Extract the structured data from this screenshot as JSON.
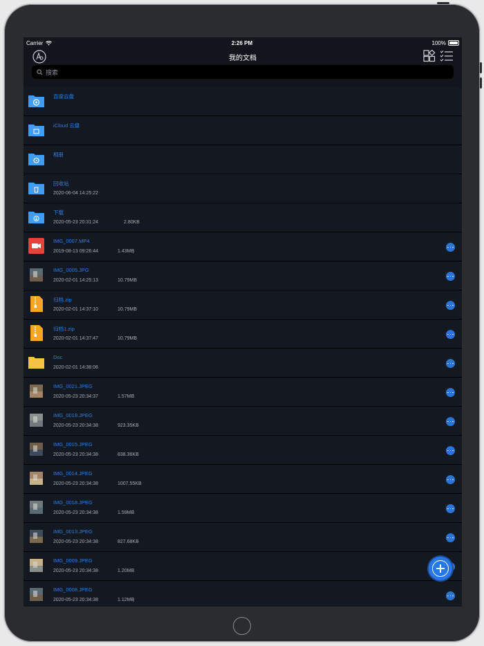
{
  "status_bar": {
    "carrier": "Carrier",
    "time": "2:26 PM",
    "battery": "100%"
  },
  "nav": {
    "title": "我的文档"
  },
  "search": {
    "placeholder": "搜索"
  },
  "files": [
    {
      "name": "百度云盘",
      "date": "",
      "size": "",
      "icon": "folder-baidu-icon",
      "more": false
    },
    {
      "name": "iCloud 云盘",
      "date": "",
      "size": "",
      "icon": "folder-icloud-icon",
      "more": false
    },
    {
      "name": "相册",
      "date": "",
      "size": "",
      "icon": "folder-photos-icon",
      "more": false
    },
    {
      "name": "回收站",
      "date": "2020-06-04 14:25:22",
      "size": "",
      "icon": "folder-trash-icon",
      "more": false
    },
    {
      "name": "下载",
      "date": "2020-05-23 20:31:24",
      "size": "2.80KB",
      "icon": "folder-download-icon",
      "more": false
    },
    {
      "name": "IMG_0007.MP4",
      "date": "2019-08-13 09:26:44",
      "size": "1.43MB",
      "icon": "video-icon",
      "more": true
    },
    {
      "name": "IMG_0005.JPG",
      "date": "2020-02-01 14:25:13",
      "size": "10.79MB",
      "icon": "image-thumbnail",
      "more": true
    },
    {
      "name": "归档.zip",
      "date": "2020-02-01 14:37:10",
      "size": "10.79MB",
      "icon": "zip-icon",
      "more": true
    },
    {
      "name": "归档1.zip",
      "date": "2020-02-01 14:37:47",
      "size": "10.79MB",
      "icon": "zip-icon",
      "more": true
    },
    {
      "name": "Doc",
      "date": "2020-02-01 14:38:06",
      "size": "",
      "icon": "folder-yellow-icon",
      "more": true
    },
    {
      "name": "IMG_0021.JPEG",
      "date": "2020-05-23 20:34:37",
      "size": "1.57MB",
      "icon": "image-thumbnail",
      "more": true
    },
    {
      "name": "IMG_0019.JPEG",
      "date": "2020-05-23 20:34:38",
      "size": "923.35KB",
      "icon": "image-thumbnail",
      "more": true
    },
    {
      "name": "IMG_0015.JPEG",
      "date": "2020-05-23 20:34:38",
      "size": "838.36KB",
      "icon": "image-thumbnail",
      "more": true
    },
    {
      "name": "IMG_0014.JPEG",
      "date": "2020-05-23 20:34:38",
      "size": "1007.55KB",
      "icon": "image-thumbnail",
      "more": true
    },
    {
      "name": "IMG_0018.JPEG",
      "date": "2020-05-23 20:34:38",
      "size": "1.59MB",
      "icon": "image-thumbnail",
      "more": true
    },
    {
      "name": "IMG_0013.JPEG",
      "date": "2020-05-23 20:34:38",
      "size": "827.68KB",
      "icon": "image-thumbnail",
      "more": true
    },
    {
      "name": "IMG_0009.JPEG",
      "date": "2020-05-23 20:34:38",
      "size": "1.20MB",
      "icon": "image-thumbnail",
      "more": true
    },
    {
      "name": "IMG_0008.JPEG",
      "date": "2020-05-23 20:34:38",
      "size": "1.12MB",
      "icon": "image-thumbnail",
      "more": true
    }
  ],
  "colors": {
    "accent": "#2e7fe0",
    "background": "#12151c",
    "folder_blue": "#3f9df3",
    "folder_yellow": "#f6c445",
    "video_red": "#e8413a"
  }
}
